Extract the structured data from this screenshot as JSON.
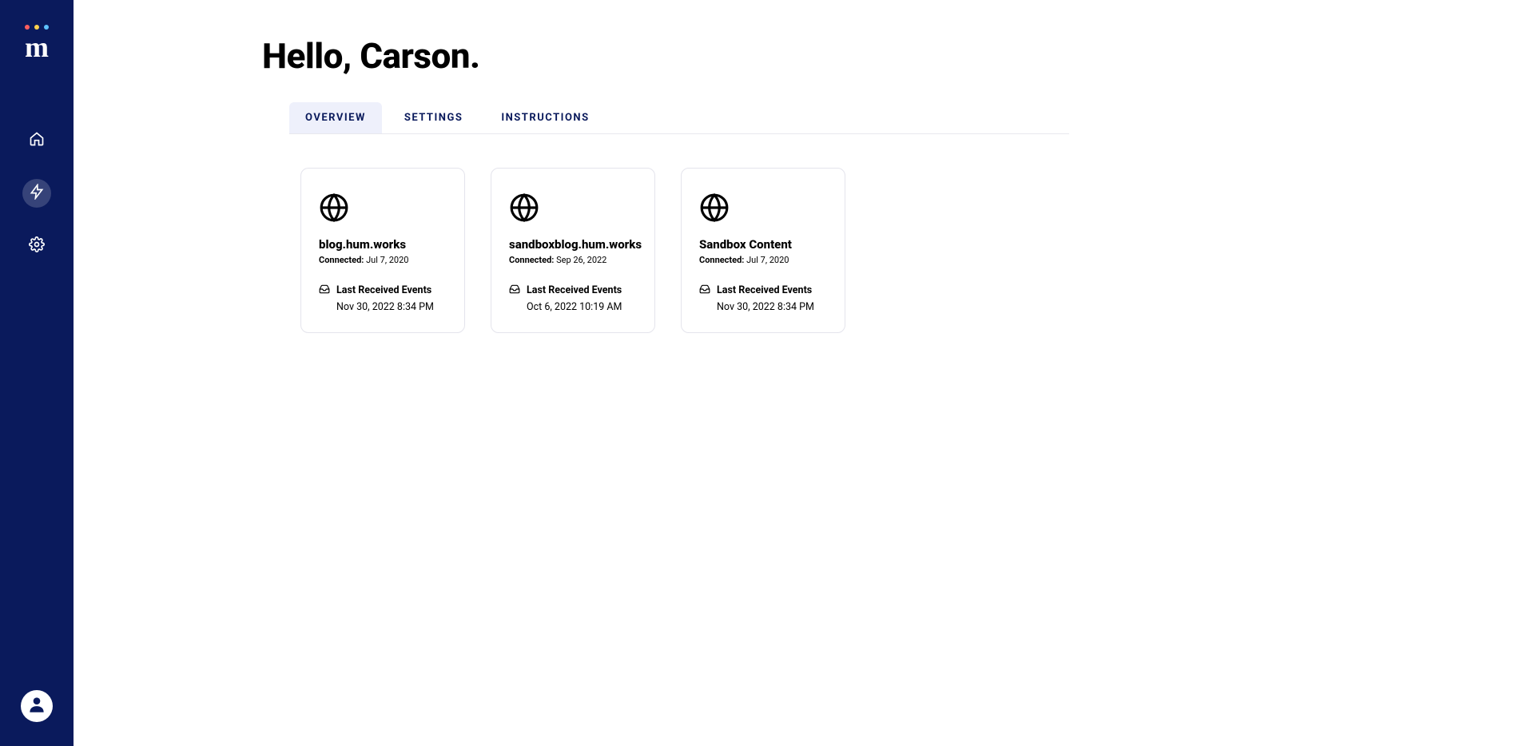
{
  "sidebar": {
    "logo_letter": "m",
    "nav": [
      {
        "name": "home",
        "active": false
      },
      {
        "name": "activity",
        "active": true
      },
      {
        "name": "settings",
        "active": false
      }
    ]
  },
  "header": {
    "greeting": "Hello, Carson."
  },
  "tabs": [
    {
      "label": "OVERVIEW",
      "active": true
    },
    {
      "label": "SETTINGS",
      "active": false
    },
    {
      "label": "INSTRUCTIONS",
      "active": false
    }
  ],
  "cards": [
    {
      "title": "blog.hum.works",
      "connected_label": "Connected:",
      "connected_date": "Jul 7, 2020",
      "events_label": "Last Received Events",
      "events_time": "Nov 30, 2022 8:34 PM"
    },
    {
      "title": "sandboxblog.hum.works",
      "connected_label": "Connected:",
      "connected_date": "Sep 26, 2022",
      "events_label": "Last Received Events",
      "events_time": "Oct 6, 2022 10:19 AM"
    },
    {
      "title": "Sandbox Content",
      "connected_label": "Connected:",
      "connected_date": "Jul 7, 2020",
      "events_label": "Last Received Events",
      "events_time": "Nov 30, 2022 8:34 PM"
    }
  ]
}
